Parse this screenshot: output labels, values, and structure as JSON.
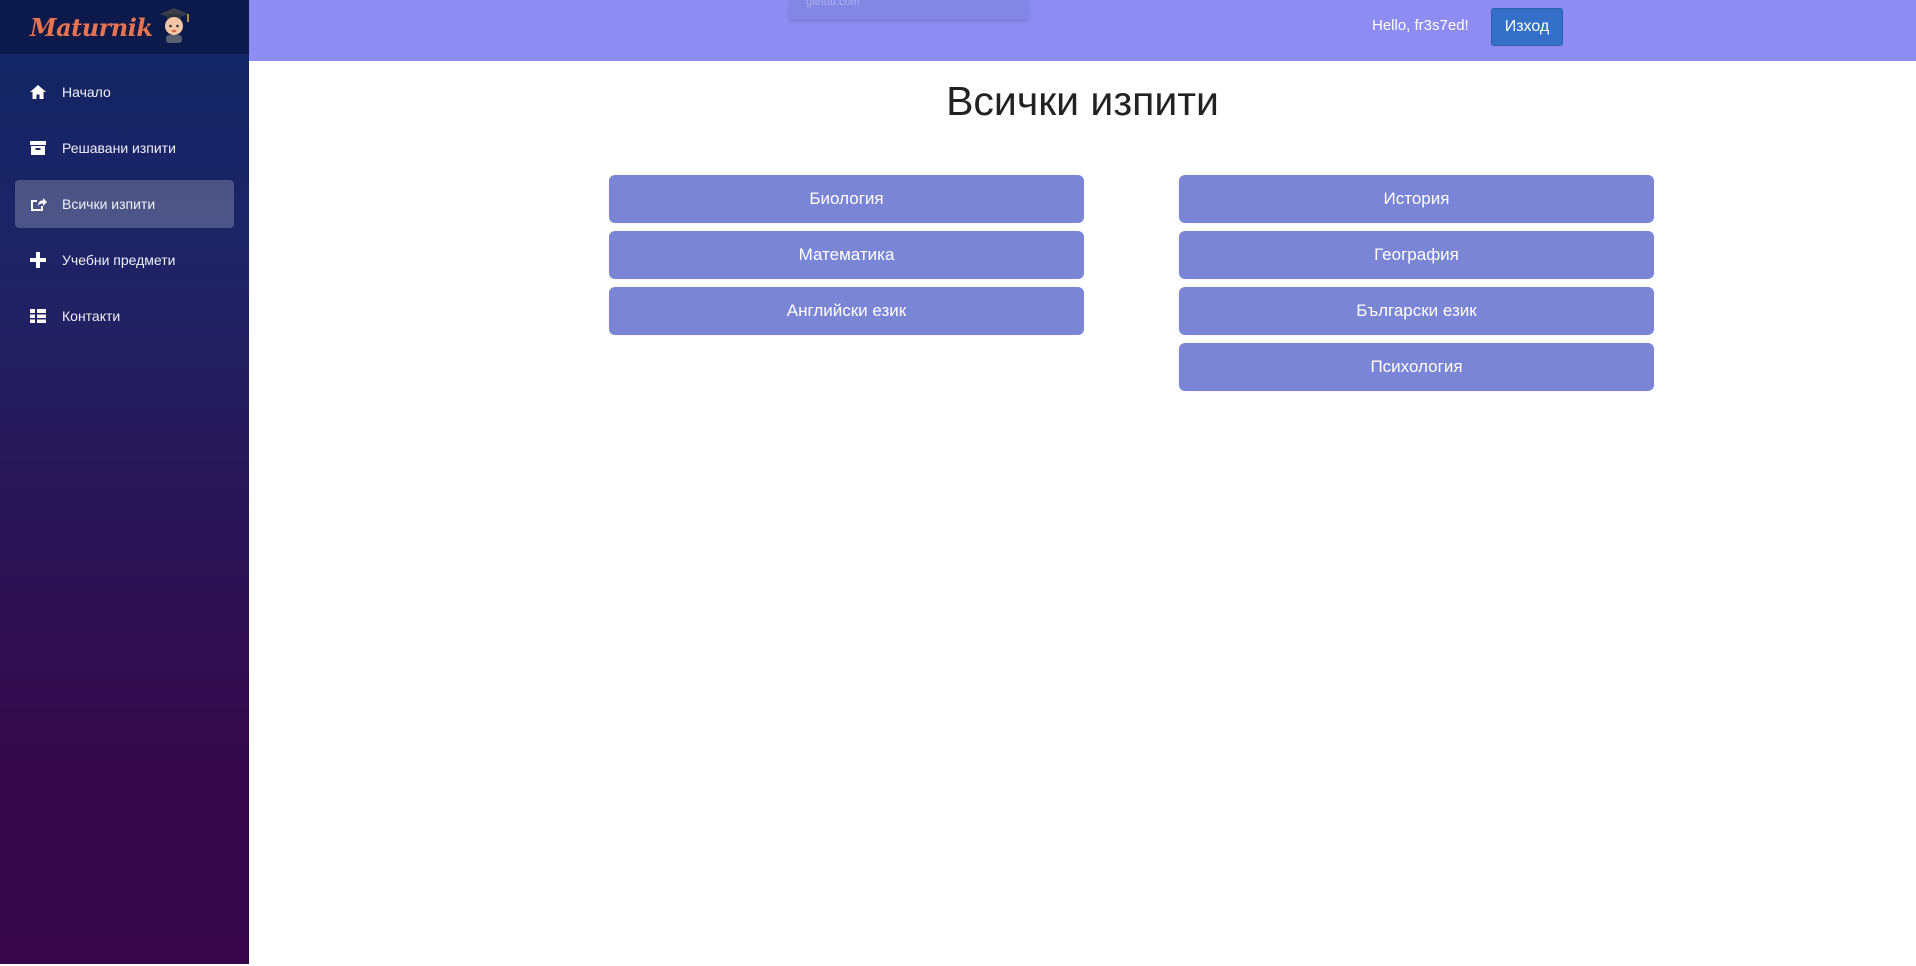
{
  "brand": {
    "name": "Maturnik"
  },
  "sidebar": {
    "items": [
      {
        "label": "Начало",
        "icon": "home-icon",
        "active": false
      },
      {
        "label": "Решавани изпити",
        "icon": "archive-icon",
        "active": false
      },
      {
        "label": "Всички изпити",
        "icon": "share-icon",
        "active": true
      },
      {
        "label": "Учебни предмети",
        "icon": "plus-icon",
        "active": false
      },
      {
        "label": "Контакти",
        "icon": "list-icon",
        "active": false
      }
    ]
  },
  "header": {
    "url_hint": "github.com",
    "greeting": "Hello, fr3s7ed!",
    "logout_label": "Изход"
  },
  "main": {
    "title": "Всички изпити",
    "left_subjects": [
      "Биология",
      "Математика",
      "Английски език"
    ],
    "right_subjects": [
      "История",
      "География",
      "Български език",
      "Психология"
    ]
  },
  "colors": {
    "header_bg": "#8c8cf2",
    "subject_button_bg": "#7a85d6",
    "logout_button_bg": "#3470c8",
    "sidebar_top": "#0f2563",
    "sidebar_bottom": "#37054a",
    "logo_text": "#e9734e"
  }
}
